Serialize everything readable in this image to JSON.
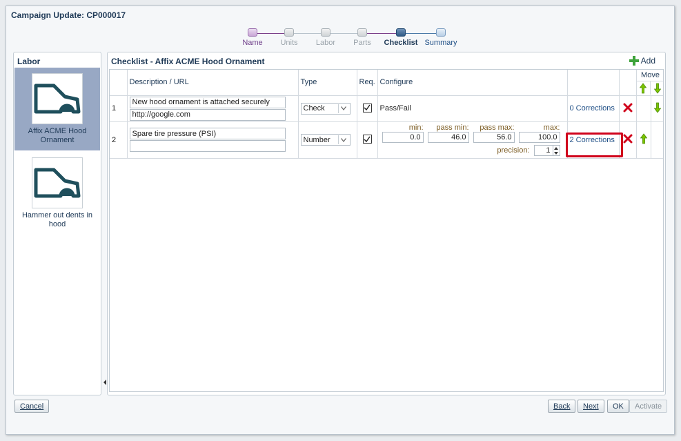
{
  "dialog": {
    "title": "Campaign Update: CP000017"
  },
  "train": {
    "stops": [
      {
        "label": "Name",
        "state": "visited"
      },
      {
        "label": "Units",
        "state": "unvisited"
      },
      {
        "label": "Labor",
        "state": "unvisited"
      },
      {
        "label": "Parts",
        "state": "unvisited"
      },
      {
        "label": "Checklist",
        "state": "current"
      },
      {
        "label": "Summary",
        "state": "next"
      }
    ]
  },
  "labor": {
    "header": "Labor",
    "items": [
      {
        "caption": "Affix ACME Hood Ornament",
        "selected": true
      },
      {
        "caption": "Hammer out dents in hood",
        "selected": false
      }
    ]
  },
  "checklist": {
    "title": "Checklist - Affix ACME Hood Ornament",
    "add_label": "Add",
    "columns": {
      "description": "Description / URL",
      "type": "Type",
      "req": "Req.",
      "configure": "Configure",
      "move": "Move"
    },
    "rows": [
      {
        "index": "1",
        "description": "New hood ornament is attached securely",
        "url": "http://google.com",
        "type": "Check",
        "required": true,
        "configure_text": "Pass/Fail",
        "corrections": "0 Corrections"
      },
      {
        "index": "2",
        "description": "Spare tire pressure (PSI)",
        "url": "",
        "type": "Number",
        "required": true,
        "min_label": "min:",
        "pass_min_label": "pass min:",
        "pass_max_label": "pass max:",
        "max_label": "max:",
        "min": "0.0",
        "pass_min": "46.0",
        "pass_max": "56.0",
        "max": "100.0",
        "precision_label": "precision:",
        "precision": "1",
        "corrections": "2 Corrections"
      }
    ]
  },
  "buttons": {
    "cancel": "Cancel",
    "back": "Back",
    "next": "Next",
    "ok": "OK",
    "activate": "Activate"
  },
  "colors": {
    "highlight": "#d0021b",
    "delete": "#d0021b",
    "move_arrow": "#7cc400",
    "accent": "#1f3a57"
  }
}
